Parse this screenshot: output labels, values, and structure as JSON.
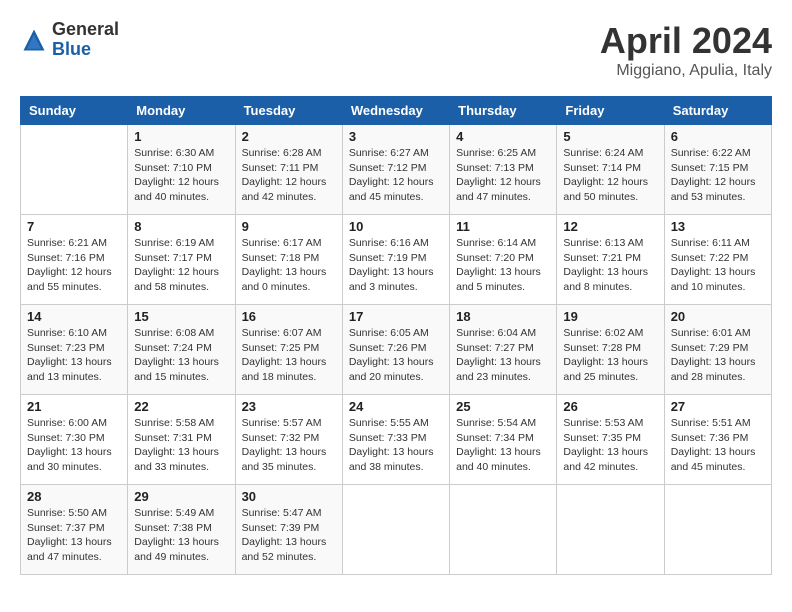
{
  "header": {
    "logo_general": "General",
    "logo_blue": "Blue",
    "month_title": "April 2024",
    "location": "Miggiano, Apulia, Italy"
  },
  "columns": [
    "Sunday",
    "Monday",
    "Tuesday",
    "Wednesday",
    "Thursday",
    "Friday",
    "Saturday"
  ],
  "weeks": [
    [
      {
        "day": "",
        "info": ""
      },
      {
        "day": "1",
        "info": "Sunrise: 6:30 AM\nSunset: 7:10 PM\nDaylight: 12 hours\nand 40 minutes."
      },
      {
        "day": "2",
        "info": "Sunrise: 6:28 AM\nSunset: 7:11 PM\nDaylight: 12 hours\nand 42 minutes."
      },
      {
        "day": "3",
        "info": "Sunrise: 6:27 AM\nSunset: 7:12 PM\nDaylight: 12 hours\nand 45 minutes."
      },
      {
        "day": "4",
        "info": "Sunrise: 6:25 AM\nSunset: 7:13 PM\nDaylight: 12 hours\nand 47 minutes."
      },
      {
        "day": "5",
        "info": "Sunrise: 6:24 AM\nSunset: 7:14 PM\nDaylight: 12 hours\nand 50 minutes."
      },
      {
        "day": "6",
        "info": "Sunrise: 6:22 AM\nSunset: 7:15 PM\nDaylight: 12 hours\nand 53 minutes."
      }
    ],
    [
      {
        "day": "7",
        "info": "Sunrise: 6:21 AM\nSunset: 7:16 PM\nDaylight: 12 hours\nand 55 minutes."
      },
      {
        "day": "8",
        "info": "Sunrise: 6:19 AM\nSunset: 7:17 PM\nDaylight: 12 hours\nand 58 minutes."
      },
      {
        "day": "9",
        "info": "Sunrise: 6:17 AM\nSunset: 7:18 PM\nDaylight: 13 hours\nand 0 minutes."
      },
      {
        "day": "10",
        "info": "Sunrise: 6:16 AM\nSunset: 7:19 PM\nDaylight: 13 hours\nand 3 minutes."
      },
      {
        "day": "11",
        "info": "Sunrise: 6:14 AM\nSunset: 7:20 PM\nDaylight: 13 hours\nand 5 minutes."
      },
      {
        "day": "12",
        "info": "Sunrise: 6:13 AM\nSunset: 7:21 PM\nDaylight: 13 hours\nand 8 minutes."
      },
      {
        "day": "13",
        "info": "Sunrise: 6:11 AM\nSunset: 7:22 PM\nDaylight: 13 hours\nand 10 minutes."
      }
    ],
    [
      {
        "day": "14",
        "info": "Sunrise: 6:10 AM\nSunset: 7:23 PM\nDaylight: 13 hours\nand 13 minutes."
      },
      {
        "day": "15",
        "info": "Sunrise: 6:08 AM\nSunset: 7:24 PM\nDaylight: 13 hours\nand 15 minutes."
      },
      {
        "day": "16",
        "info": "Sunrise: 6:07 AM\nSunset: 7:25 PM\nDaylight: 13 hours\nand 18 minutes."
      },
      {
        "day": "17",
        "info": "Sunrise: 6:05 AM\nSunset: 7:26 PM\nDaylight: 13 hours\nand 20 minutes."
      },
      {
        "day": "18",
        "info": "Sunrise: 6:04 AM\nSunset: 7:27 PM\nDaylight: 13 hours\nand 23 minutes."
      },
      {
        "day": "19",
        "info": "Sunrise: 6:02 AM\nSunset: 7:28 PM\nDaylight: 13 hours\nand 25 minutes."
      },
      {
        "day": "20",
        "info": "Sunrise: 6:01 AM\nSunset: 7:29 PM\nDaylight: 13 hours\nand 28 minutes."
      }
    ],
    [
      {
        "day": "21",
        "info": "Sunrise: 6:00 AM\nSunset: 7:30 PM\nDaylight: 13 hours\nand 30 minutes."
      },
      {
        "day": "22",
        "info": "Sunrise: 5:58 AM\nSunset: 7:31 PM\nDaylight: 13 hours\nand 33 minutes."
      },
      {
        "day": "23",
        "info": "Sunrise: 5:57 AM\nSunset: 7:32 PM\nDaylight: 13 hours\nand 35 minutes."
      },
      {
        "day": "24",
        "info": "Sunrise: 5:55 AM\nSunset: 7:33 PM\nDaylight: 13 hours\nand 38 minutes."
      },
      {
        "day": "25",
        "info": "Sunrise: 5:54 AM\nSunset: 7:34 PM\nDaylight: 13 hours\nand 40 minutes."
      },
      {
        "day": "26",
        "info": "Sunrise: 5:53 AM\nSunset: 7:35 PM\nDaylight: 13 hours\nand 42 minutes."
      },
      {
        "day": "27",
        "info": "Sunrise: 5:51 AM\nSunset: 7:36 PM\nDaylight: 13 hours\nand 45 minutes."
      }
    ],
    [
      {
        "day": "28",
        "info": "Sunrise: 5:50 AM\nSunset: 7:37 PM\nDaylight: 13 hours\nand 47 minutes."
      },
      {
        "day": "29",
        "info": "Sunrise: 5:49 AM\nSunset: 7:38 PM\nDaylight: 13 hours\nand 49 minutes."
      },
      {
        "day": "30",
        "info": "Sunrise: 5:47 AM\nSunset: 7:39 PM\nDaylight: 13 hours\nand 52 minutes."
      },
      {
        "day": "",
        "info": ""
      },
      {
        "day": "",
        "info": ""
      },
      {
        "day": "",
        "info": ""
      },
      {
        "day": "",
        "info": ""
      }
    ]
  ]
}
